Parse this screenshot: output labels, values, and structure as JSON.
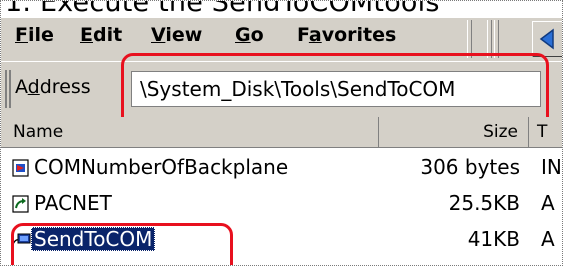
{
  "caption": "1. Execute the SendToCOMtools",
  "menu": {
    "items": [
      {
        "name": "file",
        "label": "File",
        "accel": "F",
        "rest": "ile",
        "accel_pos": 0
      },
      {
        "name": "edit",
        "label": "Edit",
        "accel": "E",
        "rest": "dit",
        "accel_pos": 0
      },
      {
        "name": "view",
        "label": "View",
        "accel": "V",
        "rest": "iew",
        "accel_pos": 0
      },
      {
        "name": "go",
        "label": "Go",
        "accel": "G",
        "rest": "o",
        "accel_pos": 0
      },
      {
        "name": "favorites",
        "label": "Favorites",
        "pre": "F",
        "accel": "a",
        "rest": "vorites"
      }
    ]
  },
  "address": {
    "label_pre": "A",
    "label_accel": "d",
    "label_rest": "dress",
    "value": "\\System_Disk\\Tools\\SendToCOM"
  },
  "columns": {
    "name": "Name",
    "size": "Size",
    "type": "T"
  },
  "files": [
    {
      "name": "COMNumberOfBackplane",
      "size": "306 bytes",
      "type": "IN",
      "icon": "settings-file-icon"
    },
    {
      "name": "PACNET",
      "size": "25.5KB",
      "type": "A",
      "icon": "shortcut-icon"
    },
    {
      "name": "SendToCOM",
      "size": "41KB",
      "type": "A",
      "icon": "application-icon",
      "selected": true
    }
  ],
  "colors": {
    "highlight": "#e8101e",
    "selection": "#0a246a",
    "chrome": "#d4d0c8"
  }
}
